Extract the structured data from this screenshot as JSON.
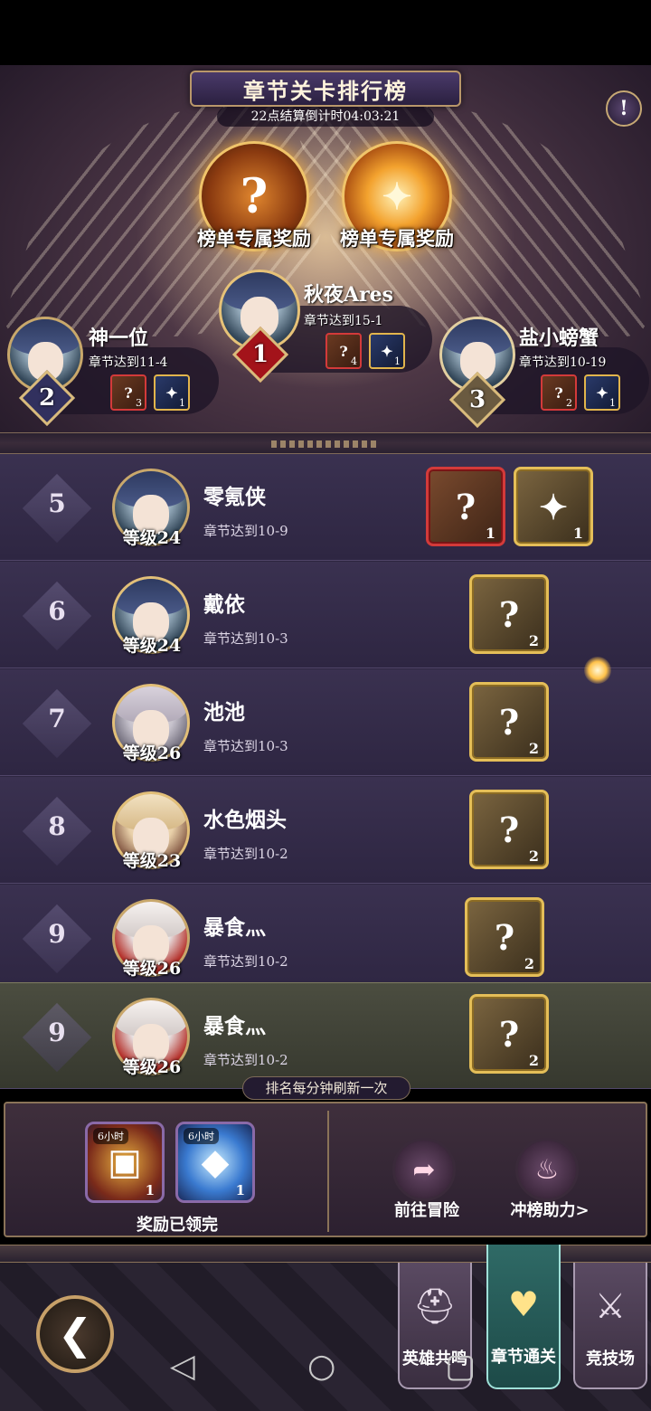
{
  "header": {
    "title": "章节关卡排行榜",
    "countdown": "22点结算倒计时04:03:21",
    "info_icon": "info-icon",
    "rewards": [
      {
        "label": "榜单专属奖励",
        "icon": "mystery-armor-icon",
        "glyph": "?"
      },
      {
        "label": "榜单专属奖励",
        "icon": "winged-staff-icon",
        "glyph": ""
      }
    ]
  },
  "podium": {
    "first": {
      "rank": "1",
      "name": "秋夜Ares",
      "progress": "章节达到15-1",
      "items": [
        {
          "glyph": "?",
          "count": "4"
        },
        {
          "glyph": "✦",
          "count": "1"
        }
      ]
    },
    "second": {
      "rank": "2",
      "name": "神一位",
      "progress": "章节达到11-4",
      "items": [
        {
          "glyph": "?",
          "count": "3"
        },
        {
          "glyph": "✦",
          "count": "1"
        }
      ]
    },
    "third": {
      "rank": "3",
      "name": "盐小螃蟹",
      "progress": "章节达到10-19",
      "items": [
        {
          "glyph": "?",
          "count": "2"
        },
        {
          "glyph": "✦",
          "count": "1"
        }
      ]
    }
  },
  "list": {
    "rows": [
      {
        "rank": "5",
        "name": "零氪侠",
        "level": "等级24",
        "progress": "章节达到10-9",
        "items": [
          {
            "glyph": "?",
            "count": "1"
          },
          {
            "glyph": "✦",
            "count": "1"
          }
        ]
      },
      {
        "rank": "6",
        "name": "戴依",
        "level": "等级24",
        "progress": "章节达到10-3",
        "items": [
          {
            "glyph": "?",
            "count": "2"
          }
        ]
      },
      {
        "rank": "7",
        "name": "池池",
        "level": "等级26",
        "progress": "章节达到10-3",
        "items": [
          {
            "glyph": "?",
            "count": "2"
          }
        ]
      },
      {
        "rank": "8",
        "name": "水色烟头",
        "level": "等级23",
        "progress": "章节达到10-2",
        "items": [
          {
            "glyph": "?",
            "count": "2"
          }
        ]
      },
      {
        "rank": "9",
        "name": "暴食灬",
        "level": "等级26",
        "progress": "章节达到10-2",
        "items": [
          {
            "glyph": "?",
            "count": "2"
          }
        ]
      }
    ],
    "self": {
      "rank": "9",
      "name": "暴食灬",
      "level": "等级26",
      "progress": "章节达到10-2",
      "items": [
        {
          "glyph": "?",
          "count": "2"
        }
      ]
    },
    "refresh_note": "排名每分钟刷新一次"
  },
  "reward_panel": {
    "boxes": [
      {
        "tag": "6小时",
        "count": "1",
        "icon": "gold-chest-icon",
        "glyph": "▣"
      },
      {
        "tag": "6小时",
        "count": "1",
        "icon": "crystal-pile-icon",
        "glyph": "◆"
      }
    ],
    "claimed_text": "奖励已领完",
    "actions": [
      {
        "label": "前往冒险",
        "icon": "go-arrow-icon",
        "glyph": "➦"
      },
      {
        "label": "冲榜助力>",
        "icon": "boost-flame-icon",
        "glyph": "♨"
      }
    ]
  },
  "nav": {
    "back_glyph": "❮",
    "tabs": [
      {
        "label": "英雄共鸣",
        "icon": "helmet-icon",
        "glyph": "⛑",
        "active": false
      },
      {
        "label": "章节通关",
        "icon": "heart-emblem-icon",
        "glyph": "♥",
        "active": true
      },
      {
        "label": "竞技场",
        "icon": "crossed-swords-icon",
        "glyph": "⚔",
        "active": false
      }
    ]
  },
  "system_nav": {
    "back": "◁",
    "home": "○",
    "recents": "▢"
  },
  "colors": {
    "accent_gold": "#e4be58",
    "accent_red": "#d33a3a",
    "active_tab": "#2f6a66",
    "self_row": "#4b4d40"
  }
}
